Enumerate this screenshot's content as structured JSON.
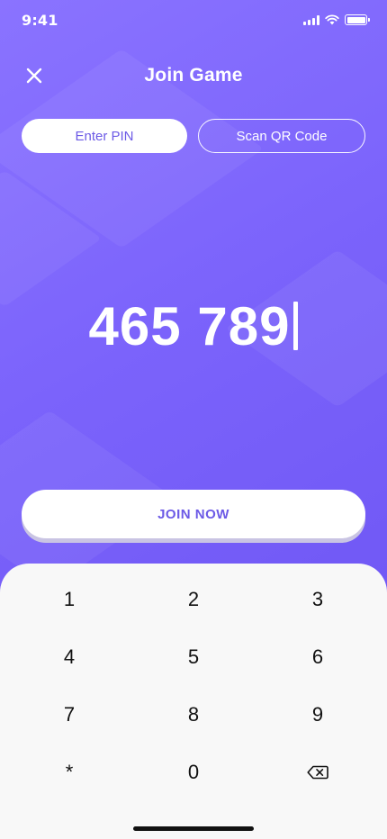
{
  "status_bar": {
    "time": "9:41",
    "icons": [
      "signal-icon",
      "wifi-icon",
      "battery-icon"
    ]
  },
  "header": {
    "close_icon": "close-icon",
    "title": "Join Game"
  },
  "tabs": [
    {
      "label": "Enter PIN",
      "active": true
    },
    {
      "label": "Scan QR Code",
      "active": false
    }
  ],
  "pin": {
    "value": "465 789"
  },
  "join_button": {
    "label": "JOIN NOW"
  },
  "keypad": {
    "keys": [
      "1",
      "2",
      "3",
      "4",
      "5",
      "6",
      "7",
      "8",
      "9",
      "*",
      "0"
    ],
    "backspace_icon": "backspace-icon"
  },
  "colors": {
    "background_start": "#8a73ff",
    "background_end": "#6a52f2",
    "accent": "#6c5ae6",
    "keypad_bg": "#f8f8f8"
  }
}
